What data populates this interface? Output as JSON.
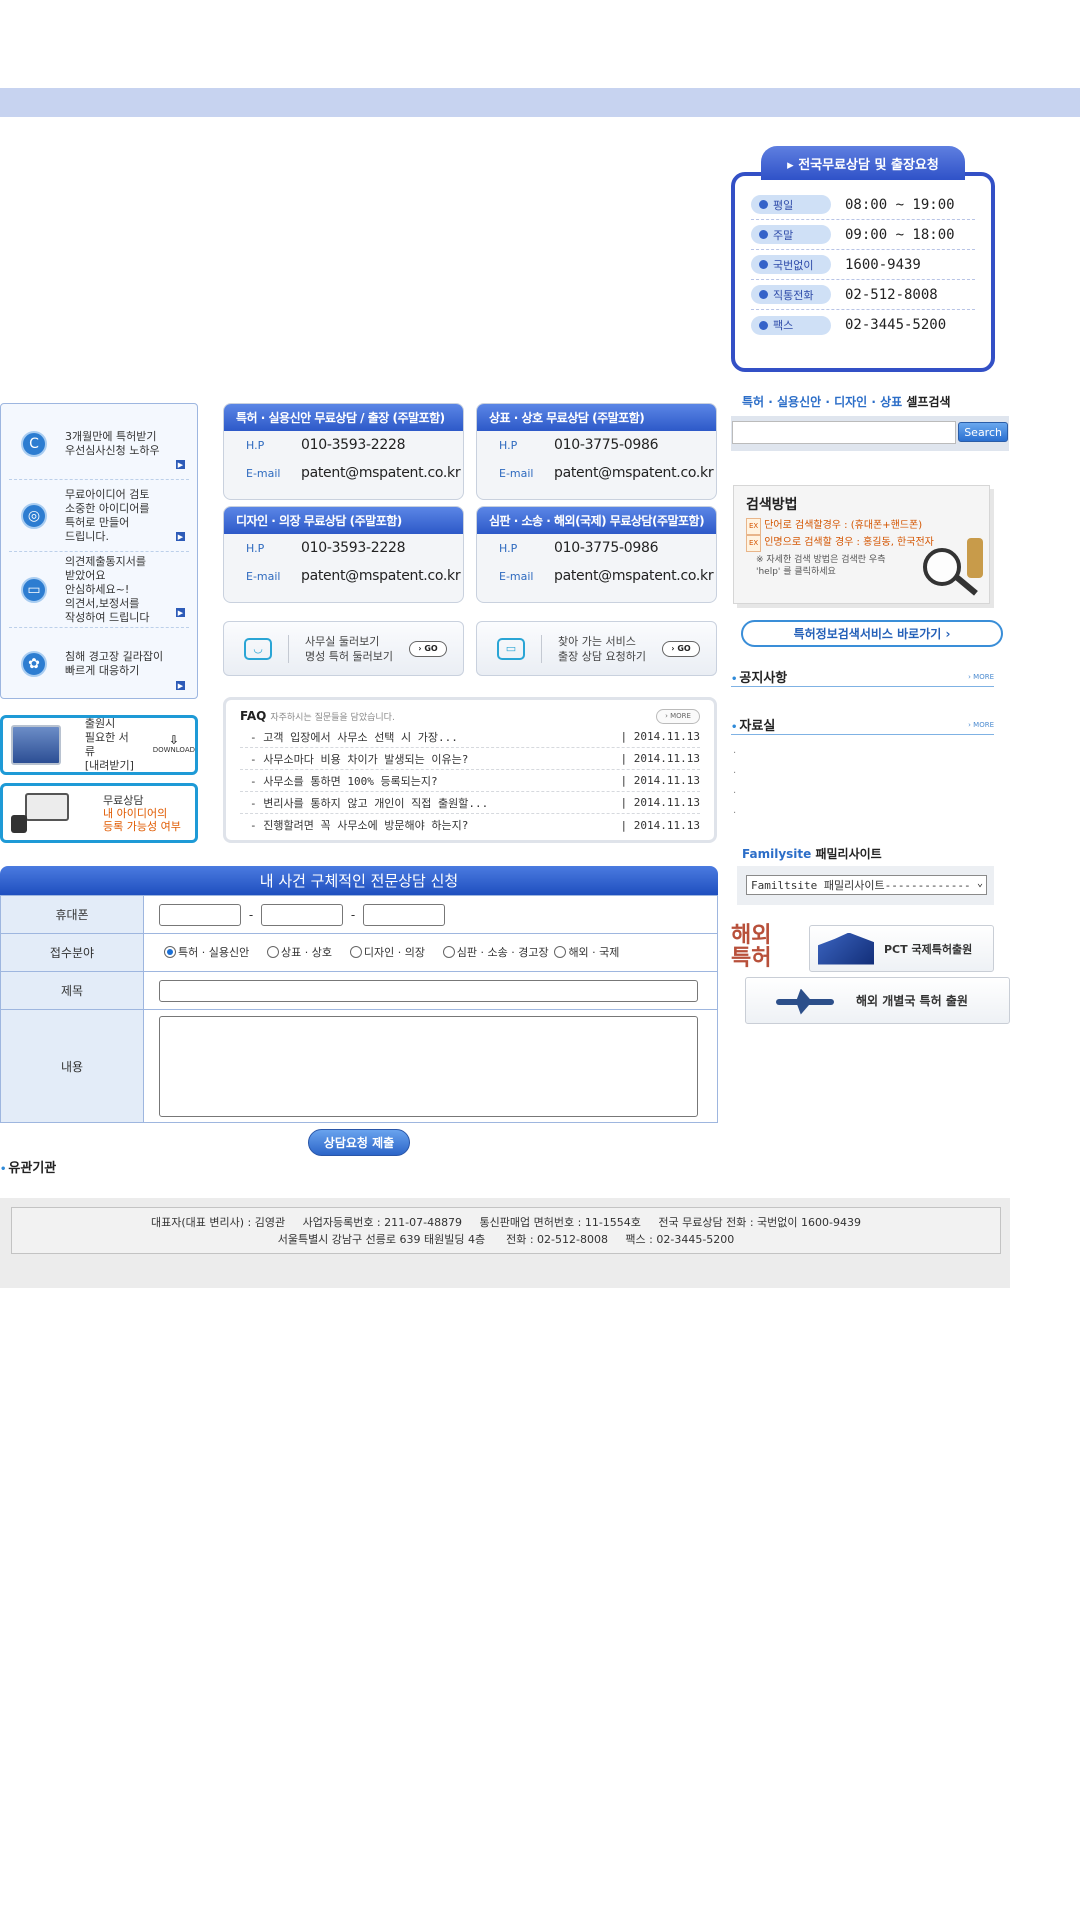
{
  "consult_panel": {
    "title": "▸ 전국무료상담 및 출장요청",
    "rows": [
      {
        "label": "평일",
        "value": "08:00 ~ 19:00"
      },
      {
        "label": "주말",
        "value": "09:00 ~ 18:00"
      },
      {
        "label": "국번없이",
        "value": "1600-9439"
      },
      {
        "label": "직통전화",
        "value": "02-512-8008"
      },
      {
        "label": "팩스",
        "value": "02-3445-5200"
      }
    ]
  },
  "left_menu": [
    {
      "text": "3개월만에 특허받기\n우선심사신청 노하우",
      "icon": "C"
    },
    {
      "text": "무료아이디어 검토\n소중한 아이디어를\n특허로 만들어\n드립니다.",
      "icon": "◎"
    },
    {
      "text": "의견제출통지서를\n받았어요\n안심하세요~!\n의견서,보정서를\n작성하여 드립니다",
      "icon": "▭"
    },
    {
      "text": "침해 경고장 길라잡이\n빠르게 대응하기",
      "icon": "✿"
    }
  ],
  "download": {
    "text": "출원시\n필요한 서류\n[내려받기]",
    "icon_label": "DOWNLOAD"
  },
  "free_consult": {
    "line1": "무료상담",
    "line2": "내 아이디어의",
    "line3": "등록 가능성 여부"
  },
  "consult_boxes": [
    {
      "title": "특허 · 실용신안 무료상담 / 출장 (주말포함)",
      "hp_label": "H.P",
      "hp": "010-3593-2228",
      "email_label": "E-mail",
      "email": "patent@mspatent.co.kr"
    },
    {
      "title": "상표 · 상호 무료상담 (주말포함)",
      "hp_label": "H.P",
      "hp": "010-3775-0986",
      "email_label": "E-mail",
      "email": "patent@mspatent.co.kr"
    },
    {
      "title": "디자인 · 의장 무료상담 (주말포함)",
      "hp_label": "H.P",
      "hp": "010-3593-2228",
      "email_label": "E-mail",
      "email": "patent@mspatent.co.kr"
    },
    {
      "title": "심판 · 소송 · 해외(국제) 무료상담(주말포함)",
      "hp_label": "H.P",
      "hp": "010-3775-0986",
      "email_label": "E-mail",
      "email": "patent@mspatent.co.kr"
    }
  ],
  "services": [
    {
      "line1": "사무실 둘러보기",
      "line2": "명성 특허 둘러보기",
      "go": "GO"
    },
    {
      "line1": "찾아 가는 서비스",
      "line2": "출장 상담 요청하기",
      "go": "GO"
    }
  ],
  "faq": {
    "title": "FAQ",
    "subtitle": "자주하시는 질문들을 담았습니다.",
    "more": "› MORE",
    "items": [
      {
        "q": "- 고객 입장에서 사무소 선택 시 가장...",
        "date": "| 2014.11.13"
      },
      {
        "q": "- 사무소마다 비용 차이가 발생되는 이유는?",
        "date": "| 2014.11.13"
      },
      {
        "q": "- 사무소를 통하면 100% 등록되는지?",
        "date": "| 2014.11.13"
      },
      {
        "q": "- 변리사를 통하지 않고 개인이 직접 출원할...",
        "date": "| 2014.11.13"
      },
      {
        "q": "- 진행할려면 꼭 사무소에 방문해야 하는지?",
        "date": "| 2014.11.13"
      }
    ]
  },
  "search": {
    "label_blue": "특허 · 실용신안 · 디자인 · 상표",
    "label_black": "셀프검색",
    "button": "Search",
    "value": ""
  },
  "howto": {
    "title": "검색방법",
    "line1_tag": "EX",
    "line1": "단어로 검색할경우 : (휴대폰+핸드폰)",
    "line2_tag": "EX",
    "line2": "인명으로 검색할 경우 : 홍길동, 한국전자",
    "note": "※ 자세한 검색 방법은 검색란 우측 'help' 를 클릭하세요"
  },
  "patinfo_button": "특허정보검색서비스 바로가기  ›",
  "notice": {
    "title": "공지사항",
    "more": "› MORE"
  },
  "archive": {
    "title": "자료실",
    "more": "› MORE",
    "items": [
      "·",
      "·",
      "·",
      "·"
    ]
  },
  "family": {
    "label_blue": "Familysite",
    "label_black": "패밀리사이트",
    "selected": "Familtsite 패밀리사이트-------------"
  },
  "overseas": {
    "text": "해외\n특허",
    "pct": "PCT 국제특허출원",
    "individual": "해외 개별국 특허 출원"
  },
  "form": {
    "title": "내 사건 구체적인 전문상담 신청",
    "phone_label": "휴대폰",
    "dash": "-",
    "field_label": "접수분야",
    "options": [
      "특허 · 실용신안",
      "상표 · 상호",
      "디자인 · 의장",
      "심판 · 소송 · 경고장",
      "해외 · 국제"
    ],
    "title_label": "제목",
    "content_label": "내용",
    "submit": "상담요청 제출"
  },
  "related": "유관기관",
  "footer": {
    "line1": "대표자(대표 변리사) : 김영관     사업자등록번호 : 211-07-48879     통신판매업 면허번호 : 11-1554호     전국 무료상담 전화 : 국번없이 1600-9439",
    "line2": "서울특별시 강남구 선릉로 639 태원빌딩 4층      전화 : 02-512-8008     팩스 : 02-3445-5200"
  }
}
